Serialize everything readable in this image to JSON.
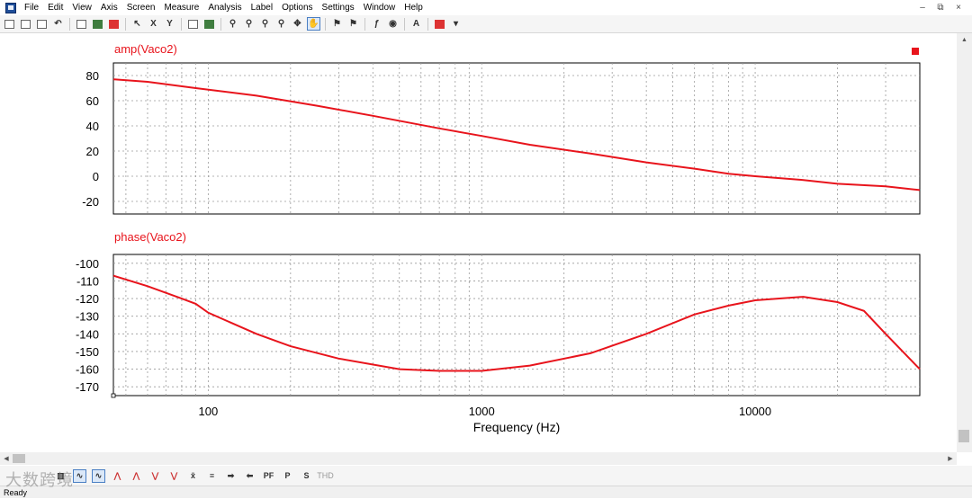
{
  "menu": [
    "File",
    "Edit",
    "View",
    "Axis",
    "Screen",
    "Measure",
    "Analysis",
    "Label",
    "Options",
    "Settings",
    "Window",
    "Help"
  ],
  "window_controls": [
    "–",
    "⧉",
    "×"
  ],
  "toolbar_icons": [
    "open-icon",
    "print-icon",
    "calculator-icon",
    "undo-icon",
    "zoom-fit-icon",
    "add-trace-icon",
    "delete-trace-icon",
    "pointer-icon",
    "x-axis-icon",
    "y-axis-icon",
    "plot-icon",
    "window-icon",
    "zoom-icon",
    "zoom-in-icon",
    "zoom-out-icon",
    "zoom-area-icon",
    "pan-icon",
    "hand-icon",
    "marker-icon",
    "label-icon",
    "fft-icon",
    "eye-icon",
    "text-icon",
    "color-icon",
    "options-icon"
  ],
  "chart_data": [
    {
      "type": "line",
      "title": "amp(Vaco2)",
      "xlabel": "",
      "ylabel": "",
      "x_scale": "log",
      "xlim": [
        45,
        40000
      ],
      "ylim": [
        -30,
        90
      ],
      "yticks": [
        80,
        60,
        40,
        20,
        0,
        -20
      ],
      "xticks": [],
      "grid": true,
      "color": "#e8141c",
      "marker_legend": "top-right",
      "series": [
        {
          "x": [
            45,
            60,
            90,
            150,
            250,
            400,
            700,
            1000,
            1500,
            2500,
            4000,
            6000,
            8000,
            10000,
            15000,
            20000,
            30000,
            40000
          ],
          "y": [
            77,
            75,
            70,
            64,
            56,
            48,
            38,
            32,
            25,
            18,
            11,
            6,
            2,
            0,
            -3,
            -6,
            -8,
            -11
          ]
        }
      ]
    },
    {
      "type": "line",
      "title": "phase(Vaco2)",
      "xlabel": "Frequency (Hz)",
      "ylabel": "",
      "x_scale": "log",
      "xlim": [
        45,
        40000
      ],
      "ylim": [
        -175,
        -95
      ],
      "yticks": [
        -100,
        -110,
        -120,
        -130,
        -140,
        -150,
        -160,
        -170
      ],
      "xticks": [
        "100",
        "1000",
        "10000"
      ],
      "grid": true,
      "color": "#e8141c",
      "series": [
        {
          "x": [
            45,
            60,
            80,
            90,
            100,
            150,
            200,
            300,
            500,
            700,
            1000,
            1500,
            2500,
            4000,
            6000,
            8000,
            10000,
            15000,
            20000,
            25000,
            30000,
            40000
          ],
          "y": [
            -107,
            -113,
            -120,
            -123,
            -128,
            -140,
            -147,
            -154,
            -160,
            -161,
            -161,
            -158,
            -151,
            -140,
            -129,
            -124,
            -121,
            -119,
            -122,
            -127,
            -140,
            -160
          ]
        }
      ]
    }
  ],
  "bottom_tools": [
    "PF",
    "P",
    "S",
    "THD"
  ],
  "bottom_misc": "Ready",
  "watermark": "大数跨境"
}
